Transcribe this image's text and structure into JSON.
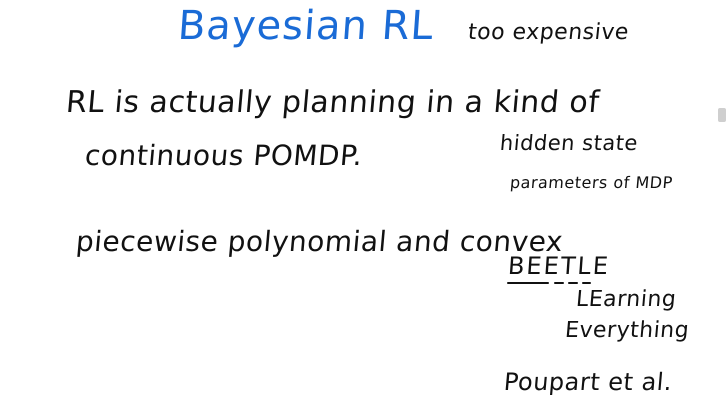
{
  "board": {
    "title": "Bayesian RL",
    "side_note": "too expensive",
    "line_1": "RL is actually planning in a kind of",
    "line_2": "continuous POMDP.",
    "hidden_state": "hidden state",
    "parameters": "parameters of MDP",
    "piecewise": "piecewise polynomial and convex",
    "beetle": "BEETLE",
    "learning": "LEarning",
    "everything": "Everything",
    "citation": "Poupart et al."
  },
  "colors": {
    "title_ink": "#1a6bd6",
    "body_ink": "#111111",
    "background": "#ffffff"
  }
}
